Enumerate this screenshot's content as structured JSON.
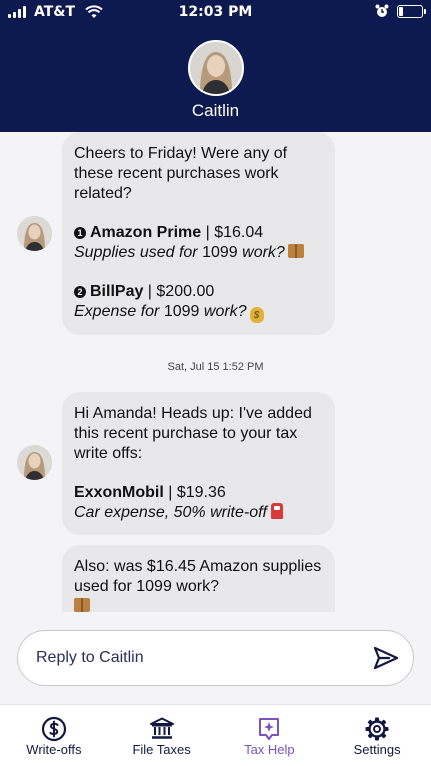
{
  "status_bar": {
    "carrier": "AT&T",
    "time": "12:03 PM",
    "battery_level": 0.18
  },
  "header": {
    "contact_name": "Caitlin"
  },
  "messages": [
    {
      "intro": "Cheers to Friday! Were any of these recent purchases work related?",
      "items": [
        {
          "number": "1",
          "merchant": "Amazon Prime",
          "separator": " | ",
          "amount": "$16.04",
          "question_italic": "Supplies used for",
          "question_plain": "1099",
          "question_tail": "work?",
          "emoji": "package-emoji"
        },
        {
          "number": "2",
          "merchant": "BillPay",
          "separator": " | ",
          "amount": "$200.00",
          "question_italic": "Expense for",
          "question_plain": "1099",
          "question_tail": "work?",
          "emoji": "money-bag-emoji"
        }
      ]
    },
    {
      "timestamp": "Sat, Jul 15 1:52 PM",
      "intro": "Hi Amanda! Heads up: I've added this recent purchase to your tax write offs:",
      "merchant": "ExxonMobil",
      "separator": " | ",
      "amount": "$19.36",
      "detail": "Car expense, 50% write-off",
      "emoji": "fuel-pump-emoji"
    },
    {
      "text": "Also: was $16.45 Amazon supplies used for 1099 work?",
      "emoji": "package-emoji"
    }
  ],
  "reply": {
    "placeholder": "Reply to Caitlin",
    "send_icon": "send-icon"
  },
  "tabs": [
    {
      "label": "Write-offs",
      "icon": "dollar-circle-icon",
      "active": false
    },
    {
      "label": "File Taxes",
      "icon": "bank-icon",
      "active": false
    },
    {
      "label": "Tax Help",
      "icon": "sparkle-chat-icon",
      "active": true
    },
    {
      "label": "Settings",
      "icon": "gear-icon",
      "active": false
    }
  ],
  "colors": {
    "header_bg": "#0c1a4f",
    "bubble_bg": "#e8e8ea",
    "active_tab": "#7a52c2",
    "tab_text": "#12183f"
  }
}
